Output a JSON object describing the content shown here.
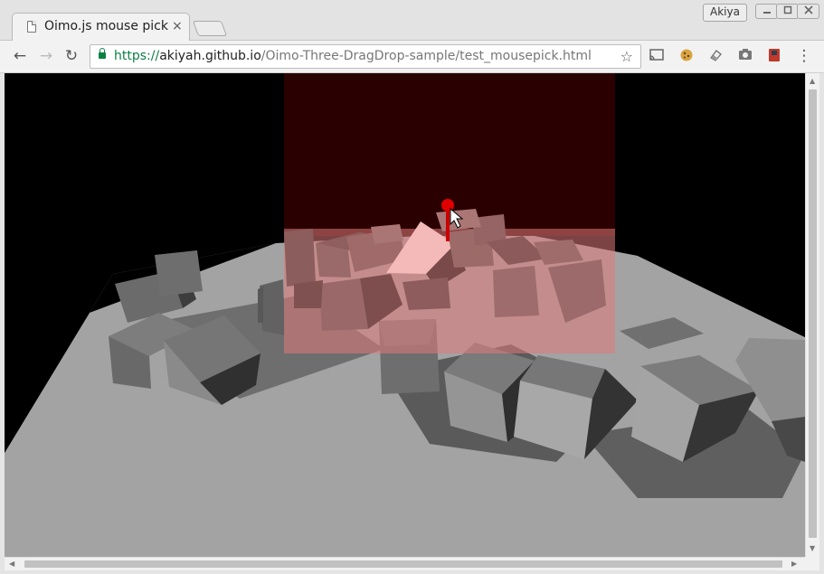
{
  "window": {
    "profile_name": "Akiya"
  },
  "tabs": [
    {
      "title": "Oimo.js mouse pick",
      "close_glyph": "×"
    }
  ],
  "toolbar": {
    "back_glyph": "←",
    "forward_glyph": "→",
    "reload_glyph": "↻",
    "url_scheme": "https://",
    "url_host": "akiyah.github.io",
    "url_path": "/Oimo-Three-DragDrop-sample/test_mousepick.html",
    "star_glyph": "☆",
    "extensions": [
      "cast-icon",
      "cookie-icon",
      "eraser-icon",
      "camera-icon",
      "book-icon"
    ],
    "menu_glyph": "⋮"
  },
  "scene": {
    "background": "#000000",
    "ground_color": "#a3a3a3",
    "highlight_color": "#e07a7a",
    "backdrop_color": "#2a0000",
    "pick_marker_color": "#e00000"
  }
}
